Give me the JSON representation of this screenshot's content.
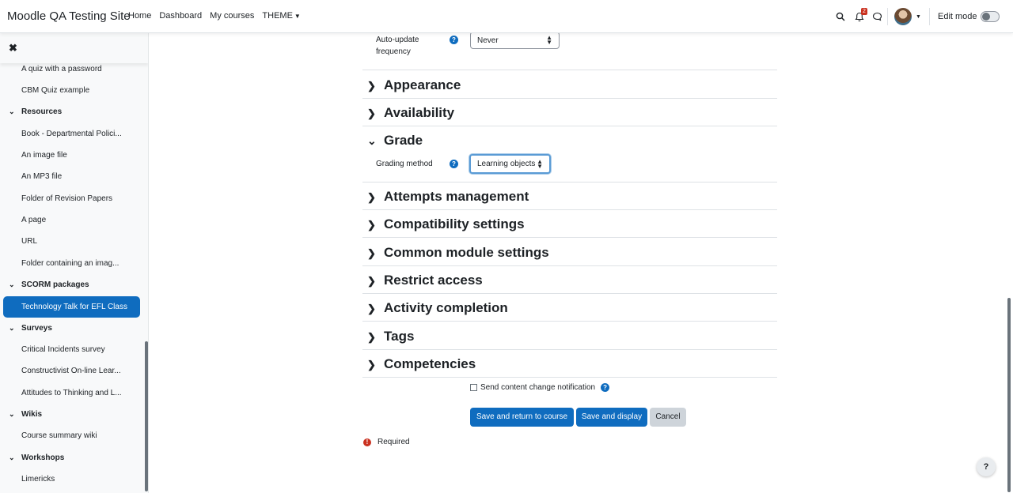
{
  "navbar": {
    "brand": "Moodle QA Testing Site",
    "links": [
      "Home",
      "Dashboard",
      "My courses",
      "THEME"
    ],
    "edit_mode_label": "Edit mode",
    "notification_count": "2"
  },
  "drawer": {
    "items": [
      {
        "type": "item",
        "label": "A quiz with a password"
      },
      {
        "type": "item",
        "label": "CBM Quiz example"
      },
      {
        "type": "section",
        "label": "Resources"
      },
      {
        "type": "item",
        "label": "Book - Departmental Polici..."
      },
      {
        "type": "item",
        "label": "An image file"
      },
      {
        "type": "item",
        "label": "An MP3 file"
      },
      {
        "type": "item",
        "label": "Folder of Revision Papers"
      },
      {
        "type": "item",
        "label": "A page"
      },
      {
        "type": "item",
        "label": "URL"
      },
      {
        "type": "item",
        "label": "Folder containing an imag..."
      },
      {
        "type": "section",
        "label": "SCORM packages"
      },
      {
        "type": "active",
        "label": "Technology Talk for EFL Class"
      },
      {
        "type": "section",
        "label": "Surveys"
      },
      {
        "type": "item",
        "label": "Critical Incidents survey"
      },
      {
        "type": "item",
        "label": "Constructivist On-line Lear..."
      },
      {
        "type": "item",
        "label": "Attitudes to Thinking and L..."
      },
      {
        "type": "section",
        "label": "Wikis"
      },
      {
        "type": "item",
        "label": "Course summary wiki"
      },
      {
        "type": "section",
        "label": "Workshops"
      },
      {
        "type": "item",
        "label": "Limericks"
      }
    ]
  },
  "form": {
    "auto_update": {
      "label": "Auto-update frequency",
      "value": "Never"
    },
    "sections": [
      {
        "label": "Appearance",
        "expanded": false
      },
      {
        "label": "Availability",
        "expanded": false
      },
      {
        "label": "Grade",
        "expanded": true
      },
      {
        "label": "Attempts management",
        "expanded": false
      },
      {
        "label": "Compatibility settings",
        "expanded": false
      },
      {
        "label": "Common module settings",
        "expanded": false
      },
      {
        "label": "Restrict access",
        "expanded": false
      },
      {
        "label": "Activity completion",
        "expanded": false
      },
      {
        "label": "Tags",
        "expanded": false
      },
      {
        "label": "Competencies",
        "expanded": false
      }
    ],
    "grading_method": {
      "label": "Grading method",
      "value": "Learning objects"
    },
    "notification_label": "Send content change notification",
    "buttons": {
      "save_return": "Save and return to course",
      "save_display": "Save and display",
      "cancel": "Cancel"
    },
    "required_label": "Required"
  },
  "colors": {
    "primary": "#0f6cbf",
    "danger": "#ca3120"
  }
}
